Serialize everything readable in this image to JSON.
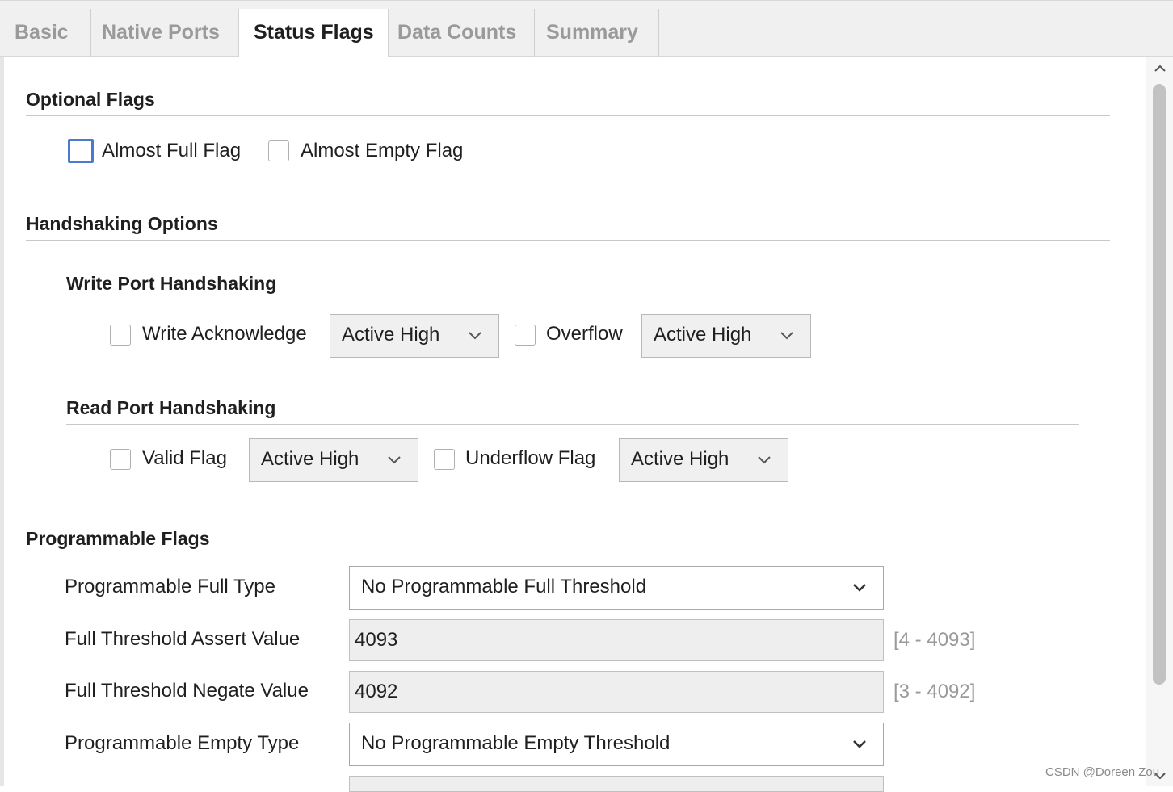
{
  "tabs": [
    {
      "label": "Basic"
    },
    {
      "label": "Native Ports"
    },
    {
      "label": "Status Flags"
    },
    {
      "label": "Data Counts"
    },
    {
      "label": "Summary"
    }
  ],
  "active_tab": "Status Flags",
  "optional_flags": {
    "title": "Optional Flags",
    "almost_full": {
      "label": "Almost Full Flag",
      "checked": false
    },
    "almost_empty": {
      "label": "Almost Empty Flag",
      "checked": false
    }
  },
  "handshaking": {
    "title": "Handshaking Options",
    "write_port": {
      "title": "Write Port Handshaking",
      "write_ack": {
        "label": "Write Acknowledge",
        "checked": false,
        "polarity": "Active High"
      },
      "overflow": {
        "label": "Overflow",
        "checked": false,
        "polarity": "Active High"
      }
    },
    "read_port": {
      "title": "Read Port Handshaking",
      "valid": {
        "label": "Valid Flag",
        "checked": false,
        "polarity": "Active High"
      },
      "underflow": {
        "label": "Underflow Flag",
        "checked": false,
        "polarity": "Active High"
      }
    }
  },
  "programmable_flags": {
    "title": "Programmable Flags",
    "full_type": {
      "label": "Programmable Full Type",
      "value": "No Programmable Full Threshold"
    },
    "full_assert": {
      "label": "Full Threshold Assert Value",
      "value": "4093",
      "range": "[4 - 4093]"
    },
    "full_negate": {
      "label": "Full Threshold Negate Value",
      "value": "4092",
      "range": "[3 - 4092]"
    },
    "empty_type": {
      "label": "Programmable Empty Type",
      "value": "No Programmable Empty Threshold"
    }
  },
  "watermark": "CSDN @Doreen Zou",
  "colors": {
    "focus_border": "#4a7bd0",
    "range_text": "#9a9a9a",
    "tab_inactive": "#9a9a9a"
  },
  "icons": {
    "dropdown": "chevron-down-icon",
    "scroll_up": "chevron-up-icon",
    "scroll_down": "chevron-down-icon"
  }
}
